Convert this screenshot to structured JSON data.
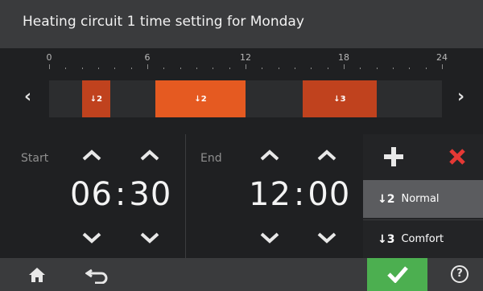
{
  "title": "Heating circuit 1 time setting for Monday",
  "timeline": {
    "tick_labels": [
      "0",
      "6",
      "12",
      "18",
      "24"
    ],
    "segments": [
      {
        "start": 2.0,
        "end": 3.75,
        "label": "2",
        "color": "#c0421e"
      },
      {
        "start": 6.5,
        "end": 12.0,
        "label": "2",
        "color": "#e55a21"
      },
      {
        "start": 15.5,
        "end": 20.0,
        "label": "3",
        "color": "#c0421e"
      }
    ],
    "prev_icon": "chevron-left-icon",
    "next_icon": "chevron-right-icon"
  },
  "start": {
    "label": "Start",
    "hours": "06",
    "minutes": "30"
  },
  "end": {
    "label": "End",
    "hours": "12",
    "minutes": "00"
  },
  "actions": {
    "add_icon": "plus-icon",
    "delete_icon": "close-icon"
  },
  "modes": [
    {
      "icon_digit": "2",
      "label": "Normal",
      "selected": true
    },
    {
      "icon_digit": "3",
      "label": "Comfort",
      "selected": false
    }
  ],
  "bottom": {
    "home_icon": "home-icon",
    "back_icon": "back-icon",
    "confirm_icon": "check-icon",
    "help_icon": "help-icon",
    "help_symbol": "?"
  },
  "colors": {
    "accent_orange": "#e55a21",
    "dark_orange": "#c0421e",
    "confirm_green": "#4caf50",
    "delete_red": "#e53935"
  }
}
